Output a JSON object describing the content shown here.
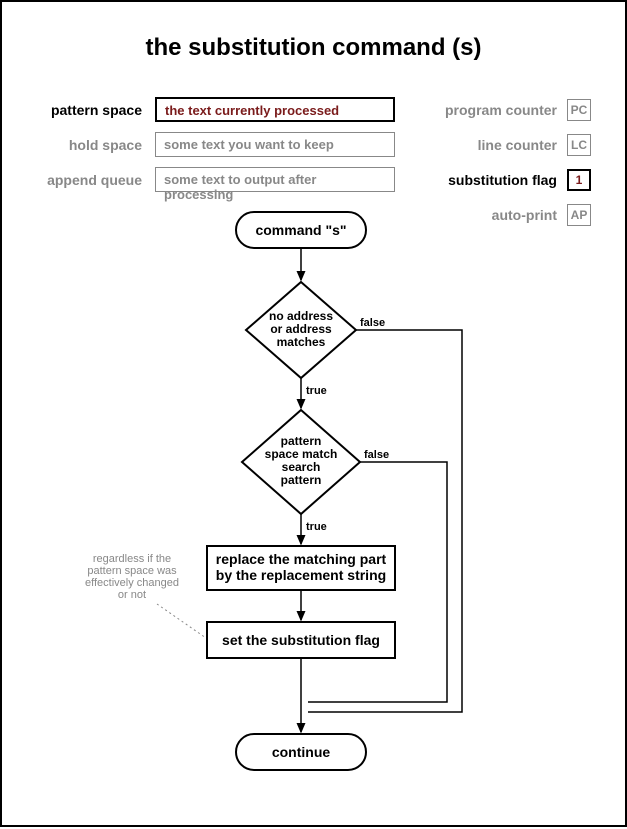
{
  "title": "the substitution command (s)",
  "left_labels": {
    "pattern_space": "pattern space",
    "hold_space": "hold space",
    "append_queue": "append queue"
  },
  "right_labels": {
    "program_counter": "program counter",
    "line_counter": "line counter",
    "substitution_flag": "substitution flag",
    "auto_print": "auto-print"
  },
  "textboxes": {
    "pattern_space": "the text currently processed",
    "hold_space": "some text you want to keep",
    "append_queue": "some text to output after processing"
  },
  "smallboxes": {
    "pc": "PC",
    "lc": "LC",
    "sf": "1",
    "ap": "AP"
  },
  "flow": {
    "start": "command \"s\"",
    "decision1_l1": "no address",
    "decision1_l2": "or address",
    "decision1_l3": "matches",
    "decision2_l1": "pattern",
    "decision2_l2": "space match",
    "decision2_l3": "search",
    "decision2_l4": "pattern",
    "box1_l1": "replace the matching part",
    "box1_l2": "by the replacement string",
    "box2": "set the substitution flag",
    "end": "continue",
    "true": "true",
    "false": "false"
  },
  "note": {
    "l1": "regardless if the",
    "l2": "pattern space was",
    "l3": "effectively changed",
    "l4": "or not"
  }
}
